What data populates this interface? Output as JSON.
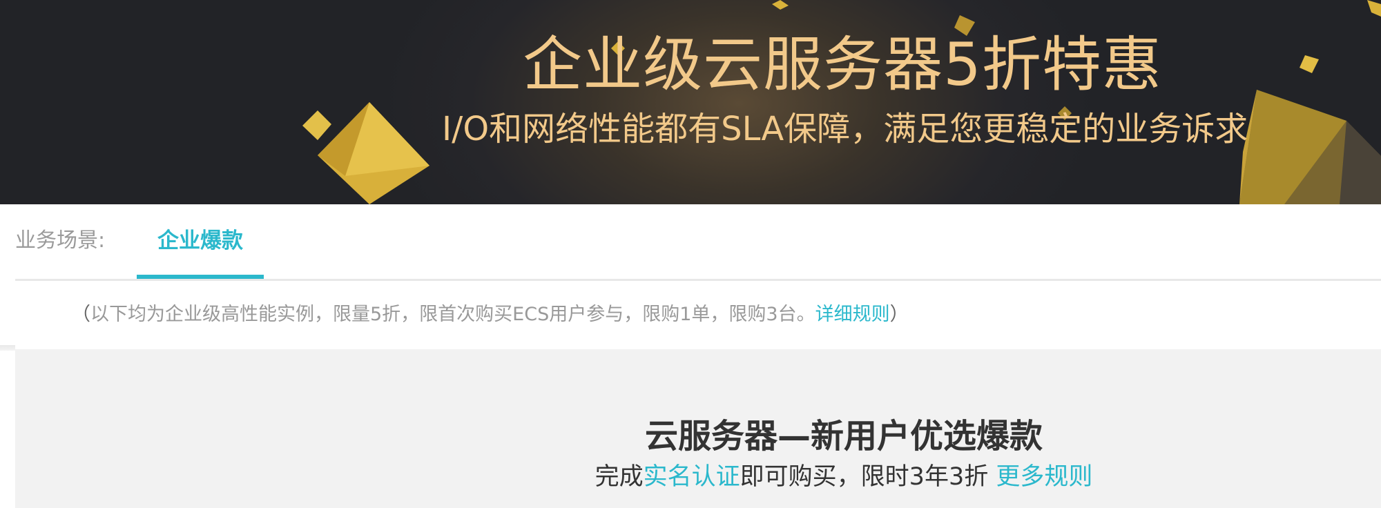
{
  "banner": {
    "title": "企业级云服务器5折特惠",
    "subtitle": "I/O和网络性能都有SLA保障，满足您更稳定的业务诉求"
  },
  "tabs": {
    "label": "业务场景:",
    "items": [
      {
        "label": "企业爆款",
        "active": true
      }
    ]
  },
  "note": {
    "open_paren": "（",
    "text": "以下均为企业级高性能实例，限量5折，限首次购买ECS用户参与，限购1单，限购3台。",
    "link": "详细规则",
    "close_paren": "）"
  },
  "section": {
    "title": "云服务器—新用户优选爆款",
    "sub_prefix": "完成",
    "sub_link": "实名认证",
    "sub_middle": "即可购买，限时3年3折 ",
    "sub_link2": "更多规则"
  },
  "colors": {
    "accent": "#2bb8cc",
    "banner_text": "#f2c98a",
    "banner_bg": "#222327",
    "gold": "#d9b23a"
  }
}
